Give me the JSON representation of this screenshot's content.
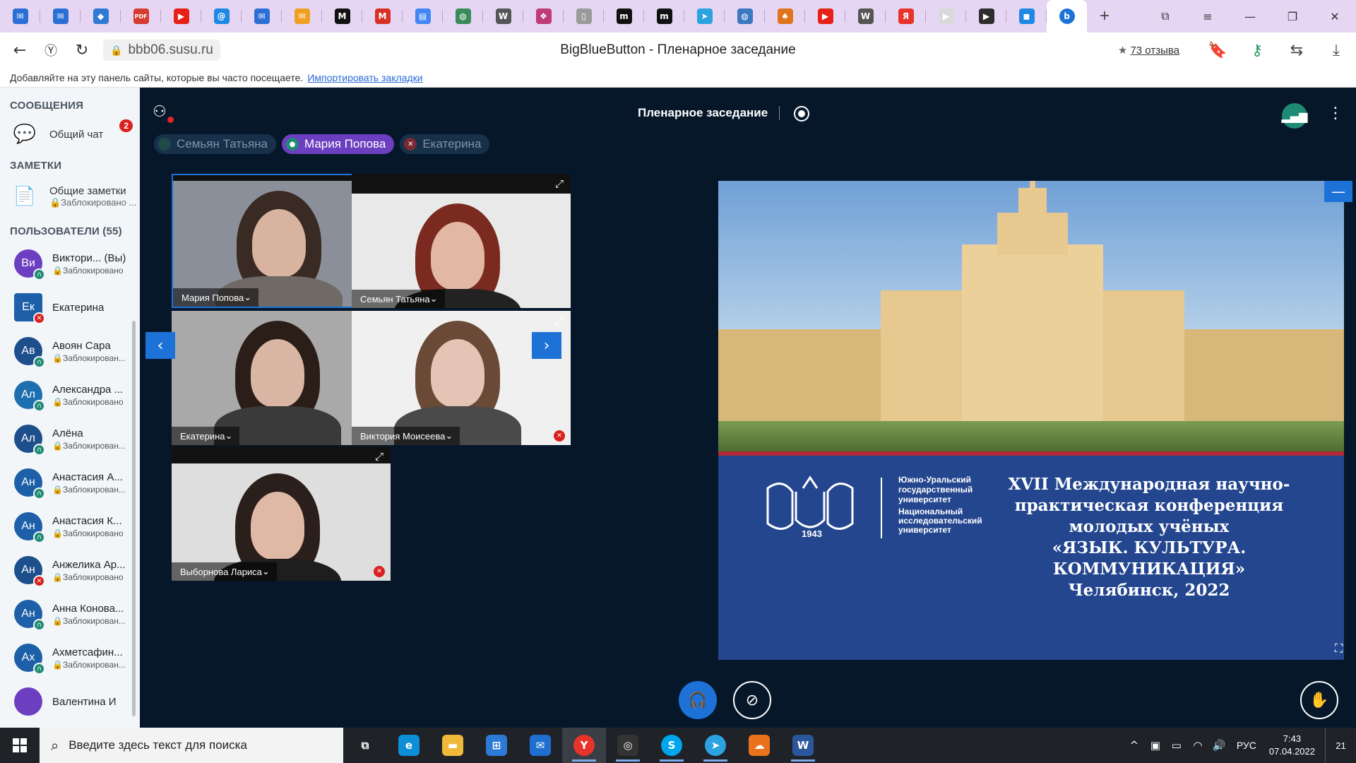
{
  "browser": {
    "address": "bbb06.susu.ru",
    "page_title": "BigBlueButton - Пленарное заседание",
    "reviews": "73 отзыва",
    "bookmarks_hint": "Добавляйте на эту панель сайты, которые вы часто посещаете.",
    "bookmarks_link": "Импортировать закладки",
    "tabs": [
      {
        "icon": "mail-icon",
        "glyph": "✉",
        "color": "#2b6fd6"
      },
      {
        "icon": "mail-icon",
        "glyph": "✉",
        "color": "#2b6fd6"
      },
      {
        "icon": "app-icon",
        "glyph": "◆",
        "color": "#2e7bd6"
      },
      {
        "icon": "pdf-icon",
        "glyph": "PDF",
        "color": "#d63b2f"
      },
      {
        "icon": "youtube-icon",
        "glyph": "▶",
        "color": "#e62117"
      },
      {
        "icon": "mailru-icon",
        "glyph": "@",
        "color": "#1e88e5"
      },
      {
        "icon": "mail-icon",
        "glyph": "✉",
        "color": "#2b6fd6"
      },
      {
        "icon": "mail-icon",
        "glyph": "✉",
        "color": "#f0a020"
      },
      {
        "icon": "medium-icon",
        "glyph": "M",
        "color": "#111111"
      },
      {
        "icon": "gmail-icon",
        "glyph": "M",
        "color": "#d93025"
      },
      {
        "icon": "doc-icon",
        "glyph": "▤",
        "color": "#4285f4"
      },
      {
        "icon": "globe-icon",
        "glyph": "◍",
        "color": "#3a8b5a"
      },
      {
        "icon": "wikipedia-icon",
        "glyph": "W",
        "color": "#555555"
      },
      {
        "icon": "app-icon",
        "glyph": "❖",
        "color": "#c0397a"
      },
      {
        "icon": "page-icon",
        "glyph": "▯",
        "color": "#9a9a9a"
      },
      {
        "icon": "more-icon",
        "glyph": "m",
        "color": "#111111"
      },
      {
        "icon": "more-icon",
        "glyph": "m",
        "color": "#111111"
      },
      {
        "icon": "telegram-icon",
        "glyph": "➤",
        "color": "#2aa3e0"
      },
      {
        "icon": "globe-icon",
        "glyph": "◍",
        "color": "#3b78c2"
      },
      {
        "icon": "app-icon",
        "glyph": "♠",
        "color": "#e0741c"
      },
      {
        "icon": "youtube-icon",
        "glyph": "▶",
        "color": "#e62117"
      },
      {
        "icon": "wikipedia-icon",
        "glyph": "W",
        "color": "#555555"
      },
      {
        "icon": "yandex-icon",
        "glyph": "Я",
        "color": "#e8332a"
      },
      {
        "icon": "video-icon",
        "glyph": "▶",
        "color": "#d9d9d9"
      },
      {
        "icon": "video-icon",
        "glyph": "▶",
        "color": "#2d2d2d"
      },
      {
        "icon": "chat-icon",
        "glyph": "◼",
        "color": "#1e88e5"
      }
    ]
  },
  "sidebar": {
    "messages_title": "СООБЩЕНИЯ",
    "chat_label": "Общий чат",
    "chat_badge": "2",
    "notes_title": "ЗАМЕТКИ",
    "notes_label": "Общие заметки",
    "notes_sub": "🔒Заблокировано ...",
    "users_title": "ПОЛЬЗОВАТЕЛИ (55)",
    "users": [
      {
        "initials": "Ви",
        "name": "Виктори... (Вы)",
        "sub": "🔒Заблокировано",
        "color": "#6b3fc0",
        "status": "listen",
        "square": false
      },
      {
        "initials": "Ек",
        "name": "Екатерина",
        "sub": "",
        "color": "#1d5fa8",
        "status": "muted",
        "square": true
      },
      {
        "initials": "Ав",
        "name": "Авоян Сара",
        "sub": "🔒Заблокирован...",
        "color": "#1d4f8c",
        "status": "listen",
        "square": false
      },
      {
        "initials": "Ал",
        "name": "Александра ...",
        "sub": "🔒Заблокировано",
        "color": "#1e6fb0",
        "status": "listen",
        "square": false
      },
      {
        "initials": "Ал",
        "name": "Алёна",
        "sub": "🔒Заблокирован...",
        "color": "#1d4f8c",
        "status": "listen",
        "square": false
      },
      {
        "initials": "Ан",
        "name": "Анастасия А...",
        "sub": "🔒Заблокирован...",
        "color": "#1d5fa8",
        "status": "listen",
        "square": false
      },
      {
        "initials": "Ан",
        "name": "Анастасия К...",
        "sub": "🔒Заблокировано",
        "color": "#1d5fa8",
        "status": "listen",
        "square": false
      },
      {
        "initials": "Ан",
        "name": "Анжелика Ар...",
        "sub": "🔒Заблокировано",
        "color": "#1d4f8c",
        "status": "muted",
        "square": false
      },
      {
        "initials": "Ан",
        "name": "Анна Конова...",
        "sub": "🔒Заблокирован...",
        "color": "#1d5fa8",
        "status": "listen",
        "square": false
      },
      {
        "initials": "Ах",
        "name": "Ахметсафин...",
        "sub": "🔒Заблокирован...",
        "color": "#1d5fa8",
        "status": "listen",
        "square": false
      },
      {
        "initials": "",
        "name": "Валентина И",
        "sub": "",
        "color": "#6b3fc0",
        "status": "",
        "square": false
      }
    ]
  },
  "meeting": {
    "title": "Пленарное заседание",
    "talkers": [
      {
        "name": "Семьян Татьяна",
        "active": false,
        "status": "listen"
      },
      {
        "name": "Мария Попова",
        "active": true,
        "status": "mic"
      },
      {
        "name": "Екатерина",
        "active": false,
        "status": "muted"
      }
    ],
    "videos": [
      {
        "name": "Мария Попова",
        "muted": false,
        "bg": "#8a8f99",
        "skin": "#d8b4a0",
        "hair": "#3a2a24",
        "cloth": "#6f6a66"
      },
      {
        "name": "Семьян Татьяна",
        "muted": false,
        "bg": "#e9e9e9",
        "skin": "#e2b8a4",
        "hair": "#7a2a1e",
        "cloth": "#222222"
      },
      {
        "name": "Екатерина",
        "muted": true,
        "bg": "#a9a9a9",
        "skin": "#d9b5a3",
        "hair": "#2b1d18",
        "cloth": "#3a3a3a"
      },
      {
        "name": "Виктория Моисеева",
        "muted": true,
        "bg": "#f0f0f0",
        "skin": "#e4c4b4",
        "hair": "#6a4a36",
        "cloth": "#4a4a4a"
      },
      {
        "name": "Выборнова Лариса",
        "muted": true,
        "bg": "#dedede",
        "skin": "#e0b8a6",
        "hair": "#2a1f1a",
        "cloth": "#1e1e1e"
      }
    ]
  },
  "presentation": {
    "uni_name": "Южно-Уральский государственный университет",
    "uni_sub": "Национальный исследовательский университет",
    "year": "1943",
    "lines": [
      "XVII Международная научно-",
      "практическая конференция",
      "молодых учёных",
      "«ЯЗЫК. КУЛЬТУРА.",
      "КОММУНИКАЦИЯ»",
      "Челябинск, 2022"
    ]
  },
  "taskbar": {
    "search_placeholder": "Введите здесь текст для поиска",
    "lang": "РУС",
    "time": "7:43",
    "date": "07.04.2022",
    "notifications": "21",
    "apps": [
      {
        "icon": "task-view-icon",
        "glyph": "⧉",
        "color": "#1f2328",
        "open": false,
        "focus": false
      },
      {
        "icon": "edge-icon",
        "glyph": "e",
        "color": "#0c8fd6",
        "open": false,
        "focus": false
      },
      {
        "icon": "explorer-icon",
        "glyph": "▬",
        "color": "#f0b93a",
        "open": false,
        "focus": false
      },
      {
        "icon": "store-icon",
        "glyph": "⊞",
        "color": "#2b7bd6",
        "open": false,
        "focus": false
      },
      {
        "icon": "mail-app-icon",
        "glyph": "✉",
        "color": "#1e6fd0",
        "open": false,
        "focus": false
      },
      {
        "icon": "yandex-browser-icon",
        "glyph": "Y",
        "color": "#e8332a",
        "open": true,
        "focus": true
      },
      {
        "icon": "app-icon",
        "glyph": "◎",
        "color": "#333333",
        "open": true,
        "focus": false
      },
      {
        "icon": "skype-icon",
        "glyph": "S",
        "color": "#00a6ed",
        "open": true,
        "focus": false
      },
      {
        "icon": "telegram-icon",
        "glyph": "➤",
        "color": "#2aa3e0",
        "open": true,
        "focus": false
      },
      {
        "icon": "cloud-icon",
        "glyph": "☁",
        "color": "#e8731c",
        "open": false,
        "focus": false
      },
      {
        "icon": "word-icon",
        "glyph": "W",
        "color": "#2b579a",
        "open": true,
        "focus": false
      }
    ]
  }
}
